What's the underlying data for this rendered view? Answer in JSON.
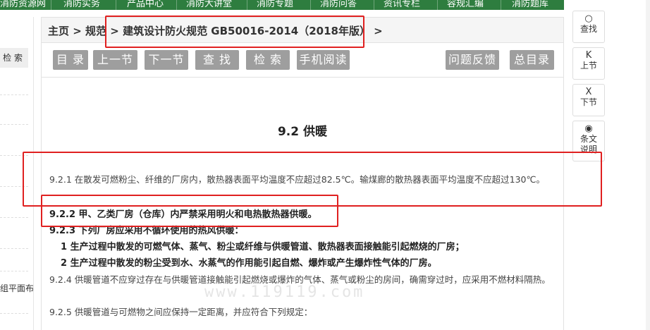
{
  "topnav": {
    "items": [
      "消防资源网",
      "消防实务",
      "产品中心",
      "消防大讲堂",
      "消防专题",
      "消防问答",
      "资讯专栏",
      "容规汇编",
      "消防题库"
    ]
  },
  "left_sidebar": {
    "search_label": "检 索",
    "partial_text": "组平面布"
  },
  "breadcrumb": {
    "home": "主页",
    "sep1": " > ",
    "spec": "规范",
    "sep2": " > ",
    "doc": "建筑设计防火规范 GB50016-2014（2018年版）",
    "sep3": " >"
  },
  "toolbar": {
    "toc": "目 录",
    "prev": "上一节",
    "next": "下一节",
    "find": "查 找",
    "search": "检 索",
    "mobile": "手机阅读",
    "feedback": "问题反馈",
    "all_toc": "总目录"
  },
  "content": {
    "section_title": "9.2 供暖",
    "p1": "9.2.1 在散发可燃粉尘、纤维的厂房内，散热器表面平均温度不应超过82.5℃。输煤廊的散热器表面平均温度不应超过130℃。",
    "p2": "9.2.2 甲、乙类厂房（仓库）内严禁采用明火和电热散热器供暖。",
    "p3": "9.2.3 下列厂房应采用不循环使用的热风供暖：",
    "p3_1": "1 生产过程中散发的可燃气体、蒸气、粉尘或纤维与供暖管道、散热器表面接触能引起燃烧的厂房；",
    "p3_2": "2 生产过程中散发的粉尘受到水、水蒸气的作用能引起自燃、爆炸或产生爆炸性气体的厂房。",
    "p4": "9.2.4 供暖管道不应穿过存在与供暖管道接触能引起燃烧或爆炸的气体、蒸气或粉尘的房间，确需穿过时，应采用不燃材料隔热。",
    "p5": "9.2.5 供暖管道与可燃物之间应保持一定距离，并应符合下列规定：",
    "watermark": "www.119119.com"
  },
  "right_tools": {
    "find": {
      "icon": "search-icon",
      "glyph": "○",
      "label": "查找"
    },
    "prev": {
      "icon": "step-backward-icon",
      "glyph": "K",
      "label": "上节"
    },
    "next": {
      "icon": "step-forward-icon",
      "glyph": "X",
      "label": "下节"
    },
    "explain": {
      "icon": "eye-icon",
      "glyph": "◉",
      "label1": "条文",
      "label2": "说明"
    }
  },
  "colors": {
    "nav_green": "#2e7d3f",
    "button_gray": "#9e9e9e",
    "annotation_red": "#e02020"
  }
}
